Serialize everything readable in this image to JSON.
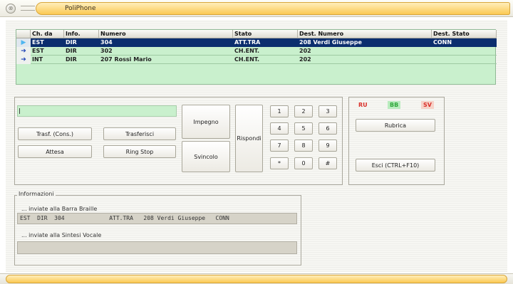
{
  "window": {
    "title": "PoliPhone",
    "close_glyph": "⊗"
  },
  "table": {
    "headers": [
      "Ch. da",
      "Info.",
      "Numero",
      "Stato",
      "Dest. Numero",
      "Dest. Stato"
    ],
    "rows": [
      {
        "indicator": "▶",
        "ch_da": "EST",
        "info": "DIR",
        "numero": "304",
        "stato": "ATT.TRA",
        "dest_numero": "208 Verdi Giuseppe",
        "dest_stato": "CONN"
      },
      {
        "indicator": "➔",
        "ch_da": "EST",
        "info": "DIR",
        "numero": "302",
        "stato": "CH.ENT.",
        "dest_numero": "202",
        "dest_stato": ""
      },
      {
        "indicator": "➔",
        "ch_da": "INT",
        "info": "DIR",
        "numero": "207 Rossi Mario",
        "stato": "CH.ENT.",
        "dest_numero": "202",
        "dest_stato": ""
      }
    ]
  },
  "controls": {
    "number_input": "",
    "trasf_cons": "Trasf. (Cons.)",
    "trasferisci": "Trasferisci",
    "attesa": "Attesa",
    "ring_stop": "Ring Stop",
    "impegno": "Impegno",
    "svincolo": "Svincolo",
    "rispondi": "Rispondi"
  },
  "keypad": [
    "1",
    "2",
    "3",
    "4",
    "5",
    "6",
    "7",
    "8",
    "9",
    "*",
    "0",
    "#"
  ],
  "right_panel": {
    "indicators": [
      {
        "label": "RU",
        "color": "#d9302a"
      },
      {
        "label": "BB",
        "color": "#2fa83a"
      },
      {
        "label": "SV",
        "color": "#d9302a"
      }
    ],
    "rubrica": "Rubrica",
    "esci": "Esci (CTRL+F10)"
  },
  "info": {
    "title": "Informazioni",
    "braille_label": "... inviate alla Barra Braille",
    "braille_text": "EST  DIR  304             ATT.TRA   208 Verdi Giuseppe   CONN",
    "voice_label": "... inviate alla Sintesi Vocale",
    "voice_text": ""
  }
}
